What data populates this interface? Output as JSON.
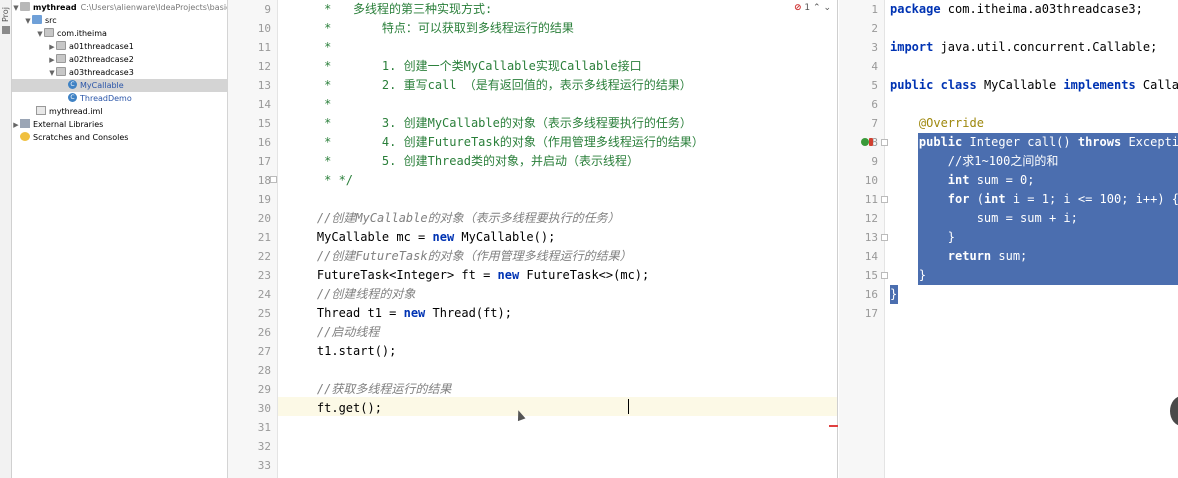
{
  "tool_strip": {
    "tab_label": "Proj"
  },
  "project": {
    "root": {
      "name": "mythread",
      "path": "C:\\Users\\alienware\\IdeaProjects\\basic-"
    },
    "items": [
      {
        "label": "src",
        "icon": "folder-icon"
      },
      {
        "label": "com.itheima",
        "icon": "package-icon"
      },
      {
        "label": "a01threadcase1",
        "icon": "package-icon"
      },
      {
        "label": "a02threadcase2",
        "icon": "package-icon"
      },
      {
        "label": "a03threadcase3",
        "icon": "package-icon"
      },
      {
        "label": "MyCallable",
        "icon": "class-icon"
      },
      {
        "label": "ThreadDemo",
        "icon": "class-icon"
      },
      {
        "label": "mythread.iml",
        "icon": "iml-file-icon"
      },
      {
        "label": "External Libraries",
        "icon": "library-icon"
      },
      {
        "label": "Scratches and Consoles",
        "icon": "scratch-icon"
      }
    ]
  },
  "left_editor": {
    "inspection": {
      "errors": "1",
      "up": "⌃",
      "down": "⌄"
    },
    "line_numbers": [
      "9",
      "10",
      "11",
      "12",
      "13",
      "14",
      "15",
      "16",
      "17",
      "18",
      "19",
      "20",
      "21",
      "22",
      "23",
      "24",
      "25",
      "26",
      "27",
      "28",
      "29",
      "30",
      "31",
      "32",
      "33"
    ],
    "lines": [
      "     *   多线程的第三种实现方式:",
      "     *       特点：可以获取到多线程运行的结果",
      "     *",
      "     *       1. 创建一个类MyCallable实现Callable接口",
      "     *       2. 重写call （是有返回值的，表示多线程运行的结果）",
      "     *",
      "     *       3. 创建MyCallable的对象（表示多线程要执行的任务）",
      "     *       4. 创建FutureTask的对象（作用管理多线程运行的结果）",
      "     *       5. 创建Thread类的对象，并启动（表示线程）",
      "     * */",
      "",
      "    //创建MyCallable的对象（表示多线程要执行的任务）",
      "    MyCallable mc = new MyCallable();",
      "    //创建FutureTask的对象（作用管理多线程运行的结果）",
      "    FutureTask<Integer> ft = new FutureTask<>(mc);",
      "    //创建线程的对象",
      "    Thread t1 = new Thread(ft);",
      "    //启动线程",
      "    t1.start();",
      "",
      "    //获取多线程运行的结果",
      "    ft.get();",
      "",
      "",
      ""
    ],
    "current_line_index": 21
  },
  "right_editor": {
    "line_numbers": [
      "1",
      "2",
      "3",
      "4",
      "5",
      "6",
      "7",
      "8",
      "9",
      "10",
      "11",
      "12",
      "13",
      "14",
      "15",
      "16",
      "17"
    ],
    "lines": [
      "package com.itheima.a03threadcase3;",
      "",
      "import java.util.concurrent.Callable;",
      "",
      "public class MyCallable implements Callable<Integer> {",
      "",
      "    @Override",
      "    public Integer call() throws Exception {",
      "        //求1~100之间的和",
      "        int sum = 0;",
      "        for (int i = 1; i <= 100; i++) {",
      "            sum = sum + i;",
      "        }",
      "        return sum;",
      "    }",
      "}",
      ""
    ],
    "selection": {
      "from_index": 7,
      "to_index": 15
    }
  },
  "colors": {
    "selection": "#4b6eaf",
    "current_line": "#fcf9e6",
    "keyword": "#0033b3",
    "comment": "#808080",
    "annotation": "#9e880d",
    "error": "#d03030"
  }
}
